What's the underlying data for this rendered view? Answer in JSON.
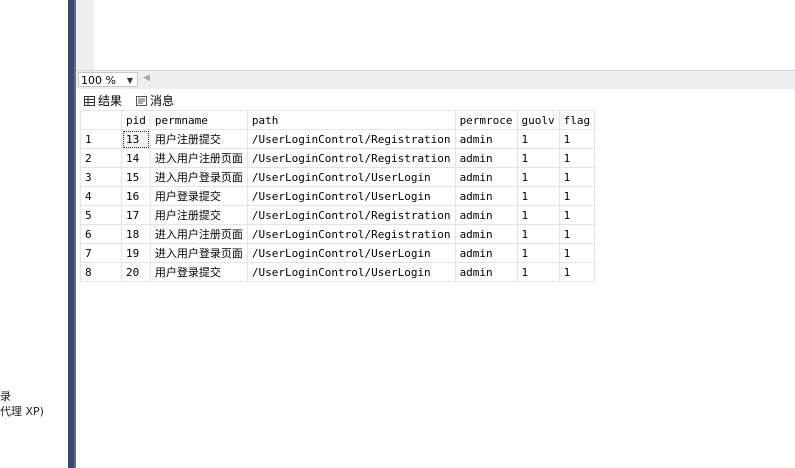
{
  "left_pane": {
    "line1": "录",
    "line2": "代理 XP)"
  },
  "zoom": {
    "value": "100 %"
  },
  "tabs": [
    {
      "label": "结果"
    },
    {
      "label": "消息"
    }
  ],
  "grid": {
    "columns": [
      "pid",
      "permname",
      "path",
      "permroce",
      "guolv",
      "flag"
    ],
    "rows": [
      {
        "n": "1",
        "pid": "13",
        "permname": "用户注册提交",
        "path": "/UserLoginControl/Registration",
        "permroce": "admin",
        "guolv": "1",
        "flag": "1"
      },
      {
        "n": "2",
        "pid": "14",
        "permname": "进入用户注册页面",
        "path": "/UserLoginControl/Registration",
        "permroce": "admin",
        "guolv": "1",
        "flag": "1"
      },
      {
        "n": "3",
        "pid": "15",
        "permname": "进入用户登录页面",
        "path": "/UserLoginControl/UserLogin",
        "permroce": "admin",
        "guolv": "1",
        "flag": "1"
      },
      {
        "n": "4",
        "pid": "16",
        "permname": "用户登录提交",
        "path": "/UserLoginControl/UserLogin",
        "permroce": "admin",
        "guolv": "1",
        "flag": "1"
      },
      {
        "n": "5",
        "pid": "17",
        "permname": "用户注册提交",
        "path": "/UserLoginControl/Registration",
        "permroce": "admin",
        "guolv": "1",
        "flag": "1"
      },
      {
        "n": "6",
        "pid": "18",
        "permname": "进入用户注册页面",
        "path": "/UserLoginControl/Registration",
        "permroce": "admin",
        "guolv": "1",
        "flag": "1"
      },
      {
        "n": "7",
        "pid": "19",
        "permname": "进入用户登录页面",
        "path": "/UserLoginControl/UserLogin",
        "permroce": "admin",
        "guolv": "1",
        "flag": "1"
      },
      {
        "n": "8",
        "pid": "20",
        "permname": "用户登录提交",
        "path": "/UserLoginControl/UserLogin",
        "permroce": "admin",
        "guolv": "1",
        "flag": "1"
      }
    ]
  }
}
